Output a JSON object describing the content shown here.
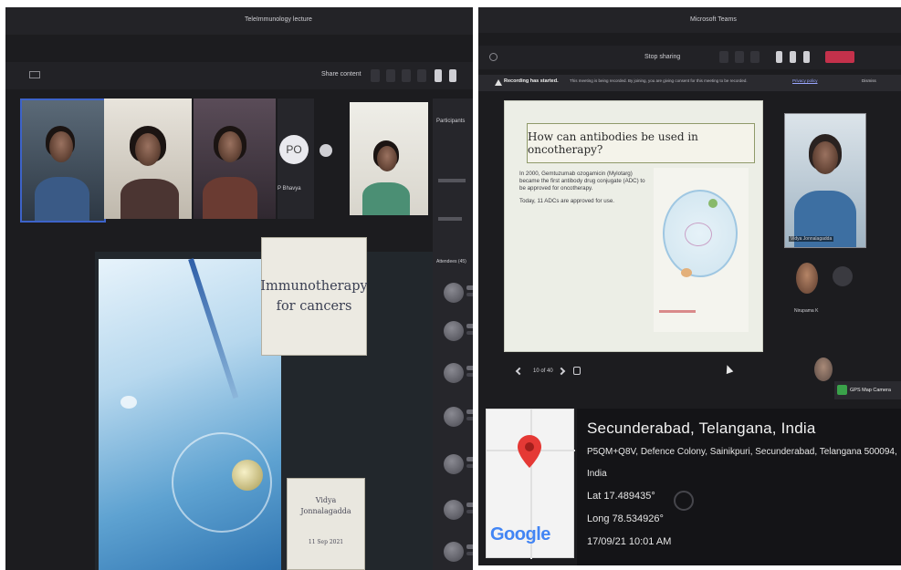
{
  "left_screenshot": {
    "window_title": "TeleImmunology lecture",
    "share_label": "Share content",
    "participant_initials": "PO",
    "participant_name": "P Bhavya",
    "slide": {
      "title_line1": "Immunotherapy",
      "title_line2": "for cancers",
      "author_line1": "Vidya",
      "author_line2": "Jonnalagadda",
      "date": "11 Sep 2021"
    },
    "panel_header": "Participants",
    "people_header": "Attendees (45)"
  },
  "right_screenshot": {
    "window_title": "Microsoft Teams",
    "share_label": "Stop sharing",
    "recording_banner": {
      "title": "Recording has started.",
      "message": "This meeting is being recorded. By joining, you are giving consent for this meeting to be recorded.",
      "link": "Privacy policy",
      "dismiss": "Dismiss"
    },
    "slide": {
      "title": "How can antibodies be used in oncotherapy?",
      "bullet1": "In 2000, Gemtuzumab ozogamicin (Mylotarg) became the first antibody drug conjugate (ADC) to be approved for oncotherapy.",
      "bullet2": "Today, 11 ADCs are approved for use.",
      "page_counter": "10 of 40"
    },
    "presenter_name": "Vidya Jonnalagadda",
    "small_tile_name": "Nirupama K",
    "camera_label": "GPS Map Camera"
  },
  "location": {
    "title": "Secunderabad, Telangana, India",
    "address_line1": "P5QM+Q8V, Defence Colony, Sainikpuri, Secunderabad, Telangana 500094,",
    "address_line2": "India",
    "lat": "Lat 17.489435°",
    "long": "Long 78.534926°",
    "datetime": "17/09/21 10:01 AM",
    "map_brand": "Google"
  },
  "colors": {
    "teams_dark": "#1c1c1f",
    "pin_red": "#e53935",
    "selection_blue": "#3d63c9",
    "slide_border": "#8f9a6a"
  }
}
